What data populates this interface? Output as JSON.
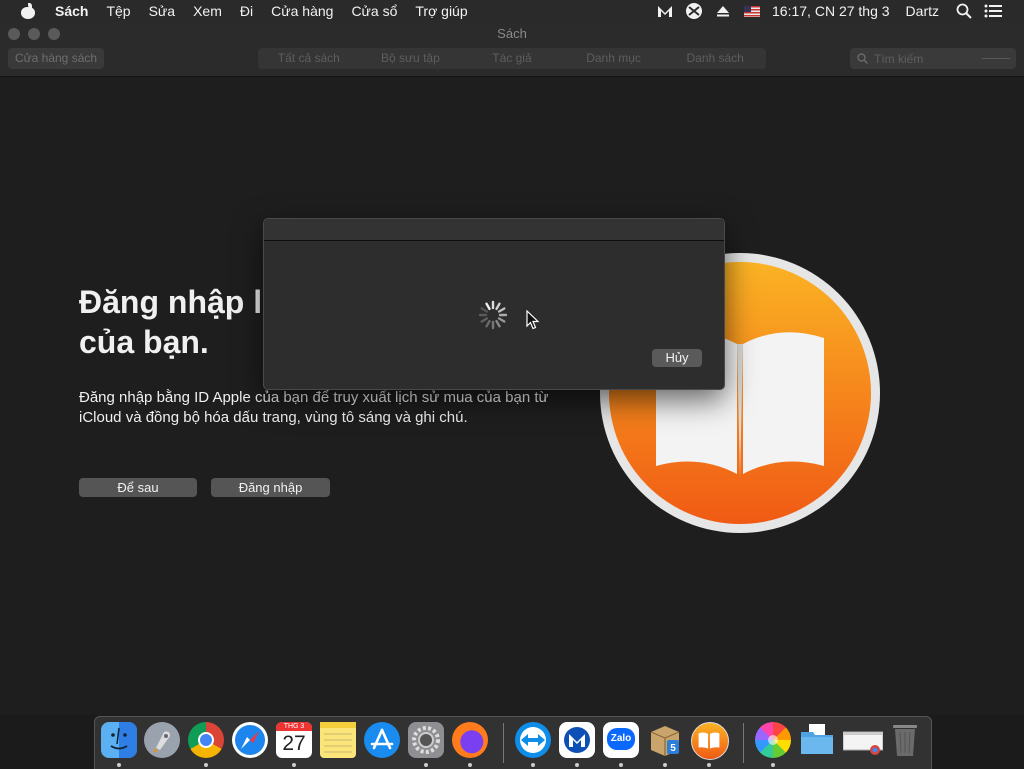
{
  "menubar": {
    "items": [
      "Sách",
      "Tệp",
      "Sửa",
      "Xem",
      "Đi",
      "Cửa hàng",
      "Cửa sổ",
      "Trợ giúp"
    ],
    "clock": "16:17, CN 27 thg 3",
    "user": "Dartz"
  },
  "window": {
    "title": "Sách",
    "store_button": "Cửa hàng sách",
    "tabs": [
      "Tất cả sách",
      "Bộ sưu tập",
      "Tác giả",
      "Danh mục",
      "Danh sách"
    ],
    "search_placeholder": "Tìm kiếm"
  },
  "main": {
    "headline_line1": "Đăng nhập l",
    "headline_line2": "của bạn.",
    "description": "Đăng nhập bằng ID Apple của bạn để truy xuất lịch sử mua của bạn từ iCloud và đồng bộ hóa dấu trang, vùng tô sáng và ghi chú.",
    "later_button": "Để sau",
    "signin_button": "Đăng nhập"
  },
  "dialog": {
    "cancel_button": "Hủy"
  },
  "dock": {
    "apps": [
      "finder-icon",
      "launchpad-icon",
      "chrome-icon",
      "safari-icon",
      "calendar-icon",
      "notes-icon",
      "app-store-icon",
      "system-preferences-icon",
      "firefox-icon",
      "teamviewer-icon",
      "malwarebytes-icon",
      "zalo-icon",
      "package-installer-icon",
      "books-icon",
      "photos-icon",
      "downloads-folder-icon",
      "chrome-app-icon",
      "trash-icon"
    ],
    "calendar_month": "THG 3",
    "calendar_day": "27",
    "zalo_label": "Zalo"
  },
  "colors": {
    "books_orange": "#f57b1d",
    "books_yellow": "#fbb324",
    "background": "#1e1e1e"
  }
}
